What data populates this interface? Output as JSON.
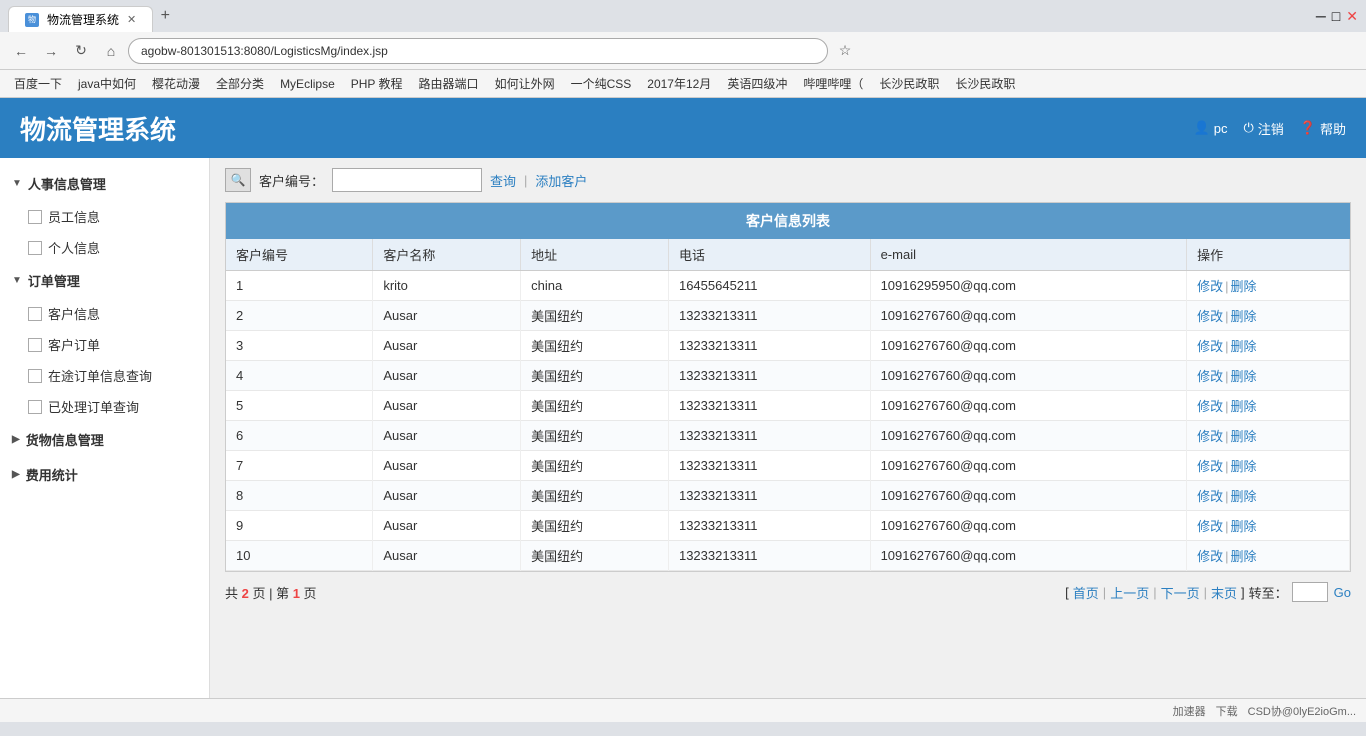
{
  "browser": {
    "tab_title": "物流管理系统",
    "address": "agobw-801301513:8080/LogisticsMg/index.jsp",
    "bookmarks": [
      "百度一下",
      "java中如何",
      "樱花动漫",
      "全部分类",
      "MyEclipse",
      "PHP 教程",
      "路由器端口",
      "如何让外网",
      "一个纯CSS",
      "2017年12月",
      "英语四级冲",
      "哔哩哔哩（",
      "长沙民政职",
      "长沙民政职"
    ]
  },
  "app": {
    "title": "物流管理系统",
    "header_actions": [
      {
        "icon": "user",
        "label": "pc"
      },
      {
        "icon": "logout",
        "label": "注销"
      },
      {
        "icon": "help",
        "label": "帮助"
      }
    ]
  },
  "sidebar": {
    "sections": [
      {
        "id": "personnel",
        "label": "人事信息管理",
        "expanded": true,
        "items": [
          {
            "id": "employee-info",
            "label": "员工信息"
          },
          {
            "id": "personal-info",
            "label": "个人信息"
          }
        ]
      },
      {
        "id": "orders",
        "label": "订单管理",
        "expanded": true,
        "items": [
          {
            "id": "customer-info",
            "label": "客户信息"
          },
          {
            "id": "customer-order",
            "label": "客户订单"
          },
          {
            "id": "order-query",
            "label": "在途订单信息查询"
          },
          {
            "id": "processed-order",
            "label": "已处理订单查询"
          }
        ]
      },
      {
        "id": "cargo",
        "label": "货物信息管理",
        "expanded": false,
        "items": []
      },
      {
        "id": "fee",
        "label": "费用统计",
        "expanded": false,
        "items": []
      }
    ]
  },
  "search": {
    "label": "客户编号：",
    "placeholder": "",
    "query_btn": "查询",
    "add_btn": "添加客户"
  },
  "table": {
    "title": "客户信息列表",
    "columns": [
      "客户编号",
      "客户名称",
      "地址",
      "电话",
      "e-mail",
      "操作"
    ],
    "rows": [
      {
        "id": "1",
        "name": "krito",
        "address": "china",
        "phone": "16455645211",
        "email": "10916295950@qq.com",
        "edit": "修改",
        "delete": "删除"
      },
      {
        "id": "2",
        "name": "Ausar",
        "address": "美国纽约",
        "phone": "13233213311",
        "email": "10916276760@qq.com",
        "edit": "修改",
        "delete": "删除"
      },
      {
        "id": "3",
        "name": "Ausar",
        "address": "美国纽约",
        "phone": "13233213311",
        "email": "10916276760@qq.com",
        "edit": "修改",
        "delete": "删除"
      },
      {
        "id": "4",
        "name": "Ausar",
        "address": "美国纽约",
        "phone": "13233213311",
        "email": "10916276760@qq.com",
        "edit": "修改",
        "delete": "删除"
      },
      {
        "id": "5",
        "name": "Ausar",
        "address": "美国纽约",
        "phone": "13233213311",
        "email": "10916276760@qq.com",
        "edit": "修改",
        "delete": "删除"
      },
      {
        "id": "6",
        "name": "Ausar",
        "address": "美国纽约",
        "phone": "13233213311",
        "email": "10916276760@qq.com",
        "edit": "修改",
        "delete": "删除"
      },
      {
        "id": "7",
        "name": "Ausar",
        "address": "美国纽约",
        "phone": "13233213311",
        "email": "10916276760@qq.com",
        "edit": "修改",
        "delete": "删除"
      },
      {
        "id": "8",
        "name": "Ausar",
        "address": "美国纽约",
        "phone": "13233213311",
        "email": "10916276760@qq.com",
        "edit": "修改",
        "delete": "删除"
      },
      {
        "id": "9",
        "name": "Ausar",
        "address": "美国纽约",
        "phone": "13233213311",
        "email": "10916276760@qq.com",
        "edit": "修改",
        "delete": "删除"
      },
      {
        "id": "10",
        "name": "Ausar",
        "address": "美国纽约",
        "phone": "13233213311",
        "email": "10916276760@qq.com",
        "edit": "修改",
        "delete": "删除"
      }
    ]
  },
  "pagination": {
    "total_pages": "2",
    "current_page": "1",
    "info_template": "共 2 页 | 第 1 页",
    "first": "首页",
    "prev": "上一页",
    "next": "下一页",
    "last": "末页",
    "goto_label": "转至：",
    "goto_btn": "Go"
  },
  "status_bar": {
    "items": [
      "加速器",
      "下载",
      "CSD协@0lyE2ioGm..."
    ]
  }
}
